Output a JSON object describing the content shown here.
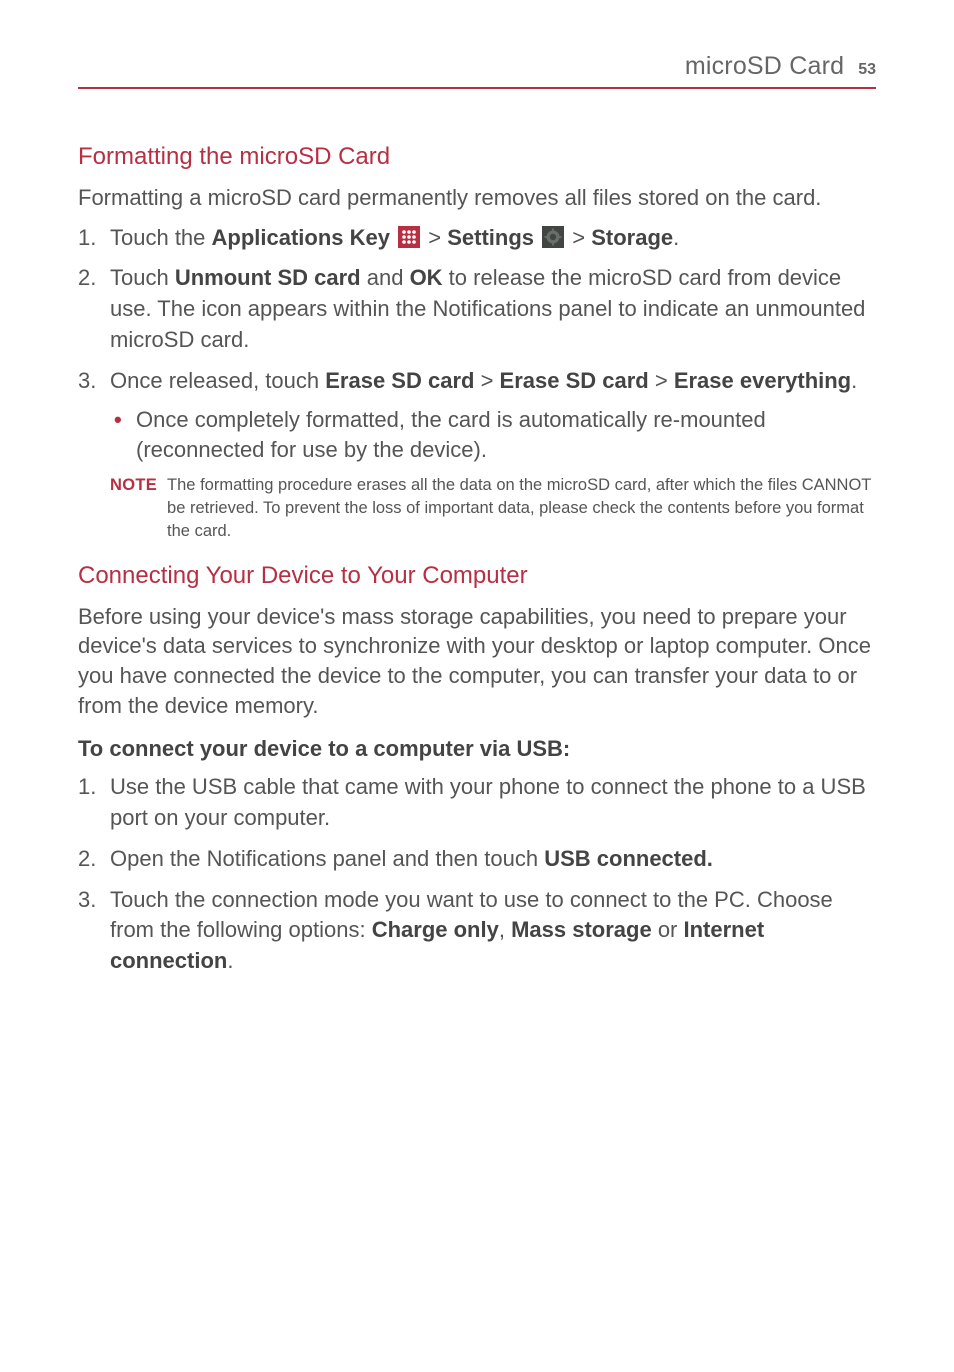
{
  "header": {
    "section": "microSD Card",
    "page_number": "53"
  },
  "section1": {
    "heading": "Formatting the microSD Card",
    "intro": "Formatting a microSD card permanently removes all files stored on the card.",
    "step1_pre": "Touch the ",
    "step1_bold1": "Applications Key",
    "step1_mid1": " > ",
    "step1_bold2": "Settings",
    "step1_mid2": " > ",
    "step1_bold3": "Storage",
    "step1_post": ".",
    "step2_pre": "Touch ",
    "step2_bold1": "Unmount SD card",
    "step2_mid": " and ",
    "step2_bold2": "OK",
    "step2_post": " to release the microSD card from device use. The icon appears within the Notifications panel to indicate an unmounted microSD card.",
    "step3_pre": "Once released, touch ",
    "step3_bold1": "Erase SD card",
    "step3_mid1": " > ",
    "step3_bold2": "Erase SD card",
    "step3_mid2": " > ",
    "step3_bold3": "Erase everything",
    "step3_post": ".",
    "bullet1": "Once completely formatted, the card is automatically re-mounted (reconnected for use by the device).",
    "note_label": "NOTE",
    "note_text": "The formatting procedure erases all the data on the microSD card, after which the files CANNOT be retrieved. To prevent the loss of important data, please check the contents before you format the card."
  },
  "section2": {
    "heading": "Connecting Your Device to Your Computer",
    "intro": "Before using your device's mass storage capabilities, you need to prepare your device's data services to synchronize with your desktop or laptop computer. Once you have connected the device to the computer, you can transfer your data to or from the device memory.",
    "subheading": "To connect your device to a computer via USB:",
    "step1": "Use the USB cable that came with your phone to connect the phone to a USB port on your computer.",
    "step2_pre": "Open the Notifications panel and then touch ",
    "step2_bold": "USB connected.",
    "step3_pre": "Touch the connection mode you want to use to connect to the PC. Choose from the following options: ",
    "step3_bold1": "Charge only",
    "step3_mid1": ", ",
    "step3_bold2": "Mass storage",
    "step3_mid2": " or ",
    "step3_bold3": "Internet connection",
    "step3_post": "."
  }
}
